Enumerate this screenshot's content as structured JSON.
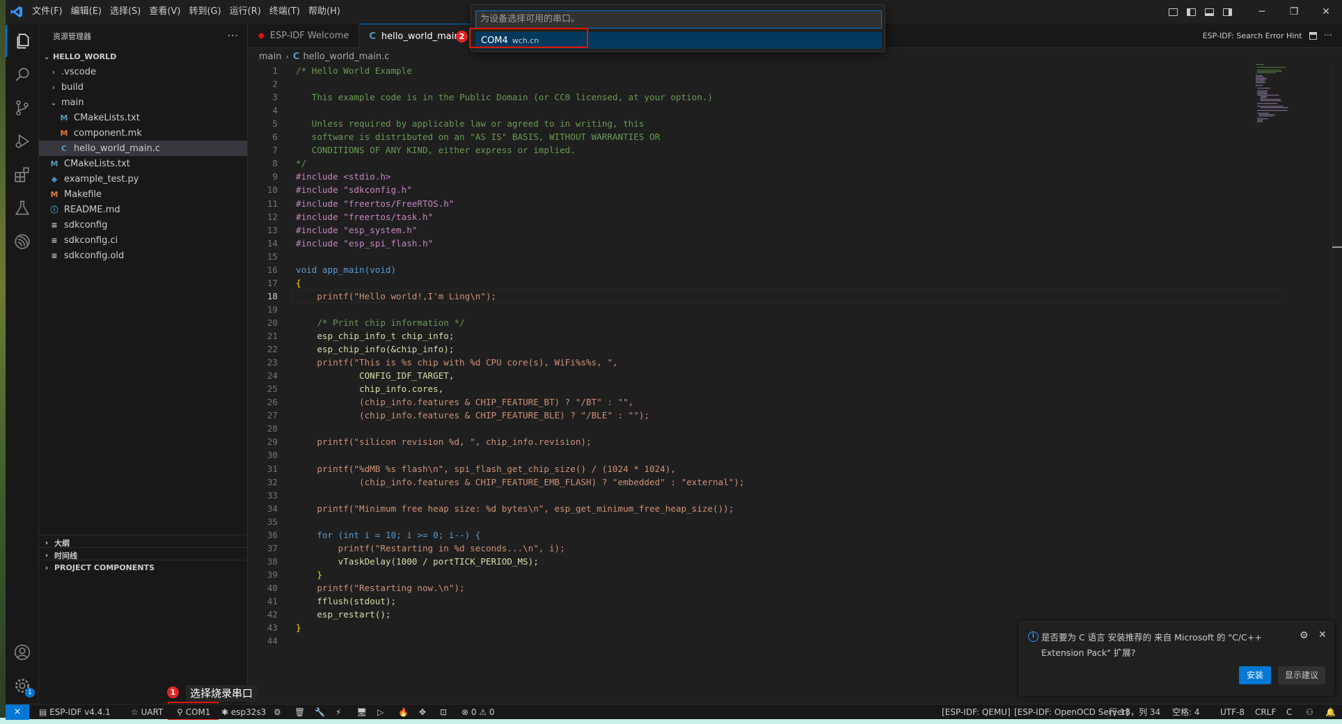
{
  "menu": [
    "文件(F)",
    "编辑(E)",
    "选择(S)",
    "查看(V)",
    "转到(G)",
    "运行(R)",
    "终端(T)",
    "帮助(H)"
  ],
  "window_controls": {
    "minimize": "─",
    "restore": "❐",
    "close": "✕"
  },
  "sidebar": {
    "title": "资源管理器",
    "more": "···",
    "root": "HELLO_WORLD",
    "items": [
      {
        "label": ".vscode",
        "chevron": "›",
        "icon": ""
      },
      {
        "label": "build",
        "chevron": "›",
        "icon": ""
      },
      {
        "label": "main",
        "chevron": "⌄",
        "icon": ""
      },
      {
        "label": "CMakeLists.txt",
        "chevron": "",
        "icon": "M",
        "icon_color": "#519aba"
      },
      {
        "label": "component.mk",
        "chevron": "",
        "icon": "M",
        "icon_color": "#e37933"
      },
      {
        "label": "hello_world_main.c",
        "chevron": "",
        "icon": "C",
        "icon_color": "#519aba"
      },
      {
        "label": "CMakeLists.txt",
        "chevron": "",
        "icon": "M",
        "icon_color": "#519aba"
      },
      {
        "label": "example_test.py",
        "chevron": "",
        "icon": "◆",
        "icon_color": "#4b8bbe"
      },
      {
        "label": "Makefile",
        "chevron": "",
        "icon": "M",
        "icon_color": "#e37933"
      },
      {
        "label": "README.md",
        "chevron": "",
        "icon": "ⓘ",
        "icon_color": "#519aba"
      },
      {
        "label": "sdkconfig",
        "chevron": "",
        "icon": "≡",
        "icon_color": "#cccccc"
      },
      {
        "label": "sdkconfig.ci",
        "chevron": "",
        "icon": "≡",
        "icon_color": "#cccccc"
      },
      {
        "label": "sdkconfig.old",
        "chevron": "",
        "icon": "≡",
        "icon_color": "#cccccc"
      }
    ],
    "sections": [
      "大纲",
      "时间线",
      "PROJECT COMPONENTS"
    ]
  },
  "tabs": [
    {
      "label": "ESP-IDF Welcome",
      "icon": "●",
      "icon_color": "#e51400"
    },
    {
      "label": "hello_world_main.",
      "icon": "C",
      "icon_color": "#519aba"
    }
  ],
  "tabs_right": "ESP-IDF: Search Error Hint",
  "breadcrumb": {
    "folder": "main",
    "file_icon": "C",
    "file": "hello_world_main.c"
  },
  "code": {
    "current_line": 18,
    "lines": [
      "/* Hello World Example",
      "",
      "   This example code is in the Public Domain (or CC0 licensed, at your option.)",
      "",
      "   Unless required by applicable law or agreed to in writing, this",
      "   software is distributed on an \"AS IS\" BASIS, WITHOUT WARRANTIES OR",
      "   CONDITIONS OF ANY KIND, either express or implied.",
      "*/",
      "#include <stdio.h>",
      "#include \"sdkconfig.h\"",
      "#include \"freertos/FreeRTOS.h\"",
      "#include \"freertos/task.h\"",
      "#include \"esp_system.h\"",
      "#include \"esp_spi_flash.h\"",
      "",
      "void app_main(void)",
      "{",
      "    printf(\"Hello world!,I'm Ling\\n\");",
      "",
      "    /* Print chip information */",
      "    esp_chip_info_t chip_info;",
      "    esp_chip_info(&chip_info);",
      "    printf(\"This is %s chip with %d CPU core(s), WiFi%s%s, \",",
      "            CONFIG_IDF_TARGET,",
      "            chip_info.cores,",
      "            (chip_info.features & CHIP_FEATURE_BT) ? \"/BT\" : \"\",",
      "            (chip_info.features & CHIP_FEATURE_BLE) ? \"/BLE\" : \"\");",
      "",
      "    printf(\"silicon revision %d, \", chip_info.revision);",
      "",
      "    printf(\"%dMB %s flash\\n\", spi_flash_get_chip_size() / (1024 * 1024),",
      "            (chip_info.features & CHIP_FEATURE_EMB_FLASH) ? \"embedded\" : \"external\");",
      "",
      "    printf(\"Minimum free heap size: %d bytes\\n\", esp_get_minimum_free_heap_size());",
      "",
      "    for (int i = 10; i >= 0; i--) {",
      "        printf(\"Restarting in %d seconds...\\n\", i);",
      "        vTaskDelay(1000 / portTICK_PERIOD_MS);",
      "    }",
      "    printf(\"Restarting now.\\n\");",
      "    fflush(stdout);",
      "    esp_restart();",
      "}",
      ""
    ]
  },
  "quick_pick": {
    "placeholder": "为设备选择可用的串口。",
    "items": [
      {
        "label": "COM4",
        "description": "wch.cn"
      }
    ],
    "step_number": "2"
  },
  "annotation": {
    "step_number": "1",
    "label": "选择烧录串口"
  },
  "notification": {
    "message": "是否要为 C 语言 安装推荐的 来自 Microsoft 的 \"C/C++ Extension Pack\" 扩展?",
    "install_label": "安装",
    "show_label": "显示建议"
  },
  "statusbar": {
    "remote": "⨯",
    "left": [
      {
        "label": "ESP-IDF v4.4.1",
        "icon": "▤"
      },
      {
        "label": "UART",
        "icon": "☆"
      },
      {
        "label": "COM1",
        "icon": "⚲"
      },
      {
        "label": "esp32s3",
        "icon": "✱"
      }
    ],
    "problems": "⊗ 0 ⚠ 0",
    "right": [
      "[ESP-IDF: QEMU]",
      "[ESP-IDF: OpenOCD Server]",
      "行 18，列 34",
      "空格: 4",
      "UTF-8",
      "CRLF",
      "C"
    ]
  },
  "activity_badge": "1",
  "colors": {
    "accent": "#0078d4",
    "highlight_red": "#e51400"
  }
}
